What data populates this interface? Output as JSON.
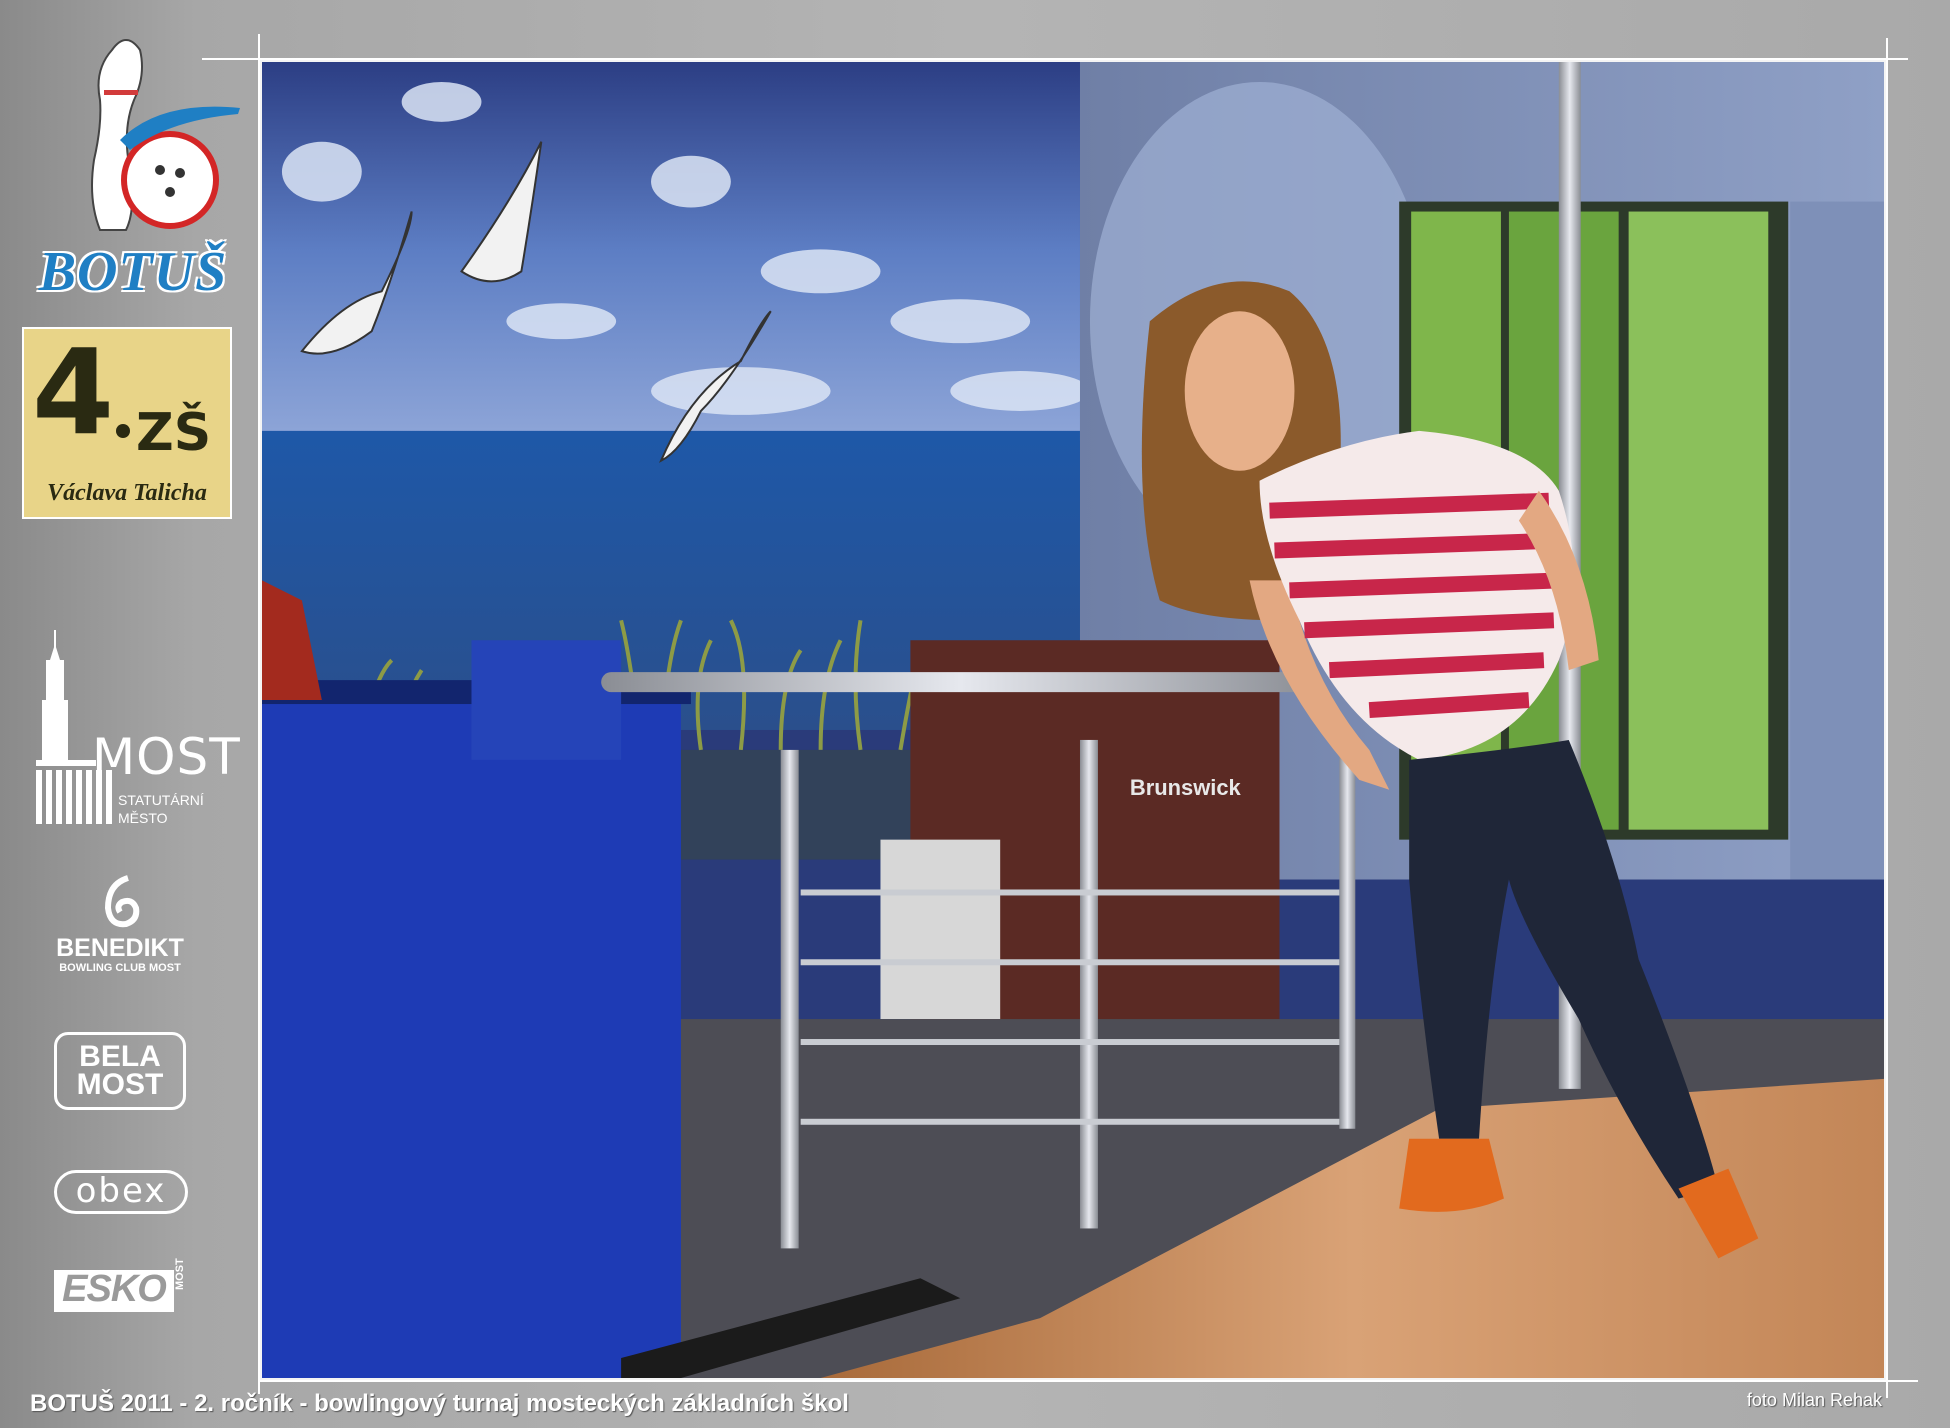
{
  "logos": {
    "botus": {
      "wordmark": "BOTUŠ"
    },
    "school": {
      "number": "4",
      "code": "ZŠ",
      "name": "Václava Talicha"
    },
    "most": {
      "word": "MOST",
      "subtitle_line1": "STATUTÁRNÍ",
      "subtitle_line2": "MĚSTO"
    },
    "benedikt": {
      "name": "BENEDIKT",
      "subtitle": "BOWLING CLUB MOST"
    },
    "bela_most": {
      "line1": "BELA",
      "line2": "MOST"
    },
    "obex": {
      "text": "obex"
    },
    "esko": {
      "text": "ESKO",
      "side": "MOST"
    }
  },
  "photo": {
    "machine_brand": "Brunswick"
  },
  "caption": "BOTUŠ 2011 - 2. ročník - bowlingový turnaj mosteckých základních škol",
  "credit": "foto Milan Rehak"
}
